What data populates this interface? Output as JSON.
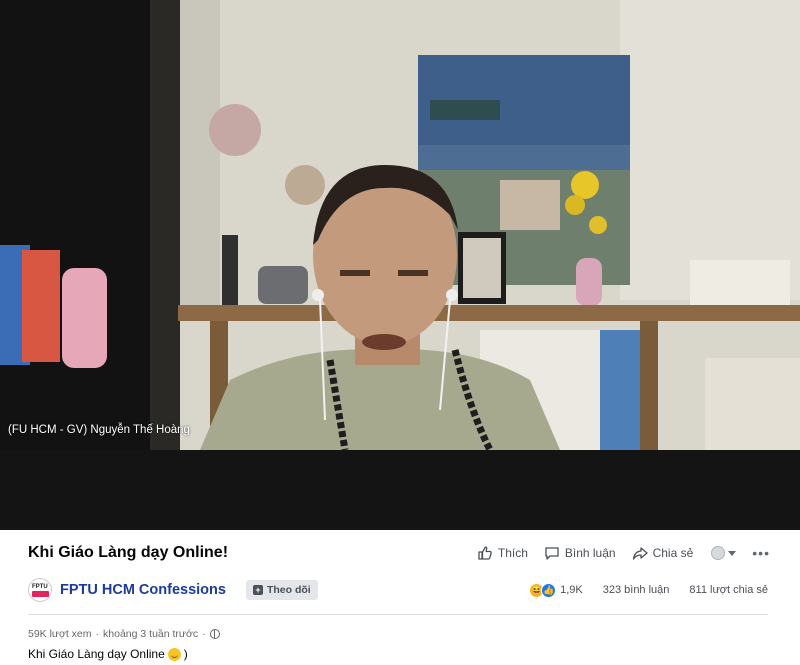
{
  "video": {
    "participant_name": "(FU HCM - GV) Nguyễn Thế Hoàng"
  },
  "post": {
    "title": "Khi Giáo Làng dạy Online!",
    "actions": {
      "like_label": "Thích",
      "comment_label": "Bình luận",
      "share_label": "Chia sẻ",
      "audience_icon": "person-icon",
      "more_icon": "more-dots-icon"
    },
    "page": {
      "name": "FPTU HCM Confessions",
      "logo_text": "FPTU",
      "follow_label": "Theo dõi"
    },
    "stats": {
      "reactions_count": "1,9K",
      "comments": "323 bình luận",
      "shares": "811 lượt chia sẻ"
    },
    "meta": {
      "views": "59K lượt xem",
      "separator": "·",
      "time": "khoảng 3 tuần trước",
      "separator2": "·"
    },
    "description": {
      "text": "Khi Giáo Làng dạy Online",
      "suffix": ")"
    },
    "colors": {
      "page_name": "#1c3b9a",
      "like_reaction": "#1877f2",
      "haha_reaction": "#f7b125"
    }
  }
}
